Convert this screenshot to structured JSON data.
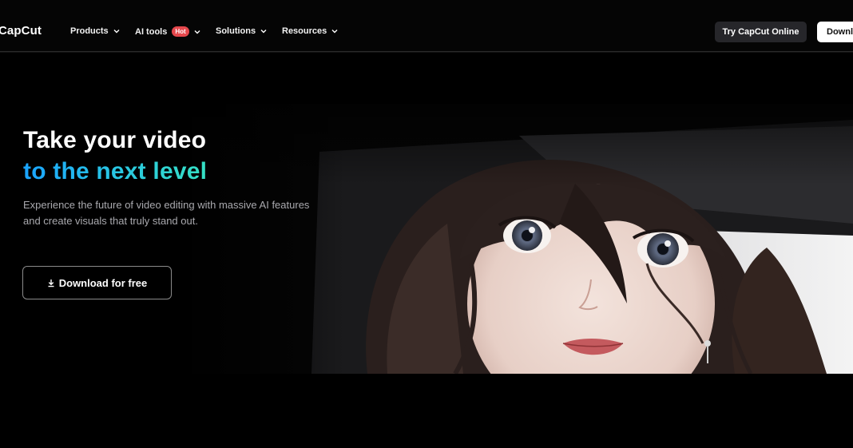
{
  "brand": {
    "name": "CapCut"
  },
  "nav": {
    "items": [
      {
        "label": "Products",
        "badge": null
      },
      {
        "label": "AI tools",
        "badge": "Hot"
      },
      {
        "label": "Solutions",
        "badge": null
      },
      {
        "label": "Resources",
        "badge": null
      }
    ],
    "try_online_label": "Try CapCut Online",
    "download_label": "Download"
  },
  "hero": {
    "headline_line1": "Take your video",
    "headline_line2": "to the next level",
    "subtitle": "Experience the future of video editing with massive AI features and create visuals that truly stand out.",
    "cta_label": "Download for free",
    "cta_icon": "download-icon"
  },
  "colors": {
    "background": "#000000",
    "accent_gradient_start": "#1aa3ff",
    "accent_gradient_end": "#35e0c4",
    "hot_badge": "#e5484d"
  }
}
